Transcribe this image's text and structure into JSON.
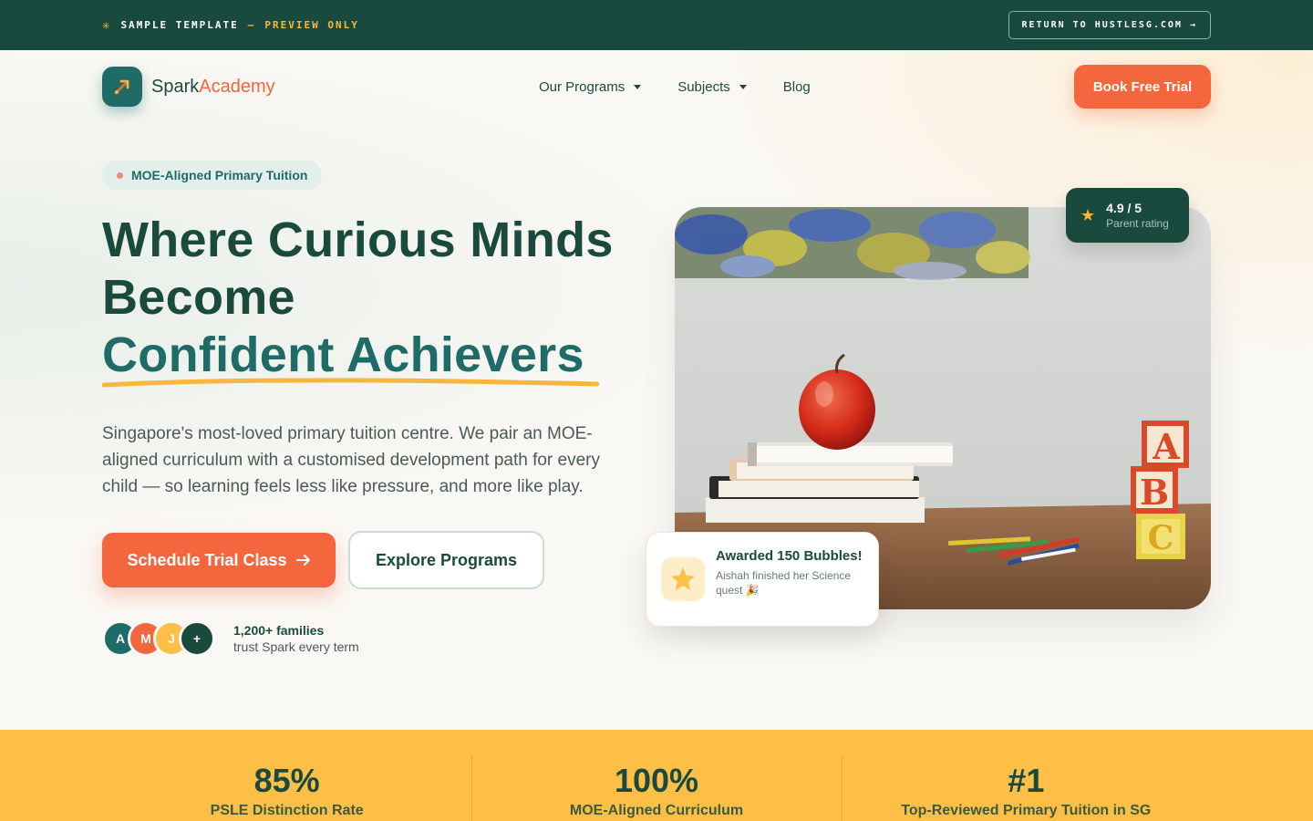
{
  "banner": {
    "template_label": "SAMPLE TEMPLATE",
    "dash": "—",
    "preview_label": "PREVIEW ONLY",
    "return_link": "RETURN TO HUSTLESG.COM →"
  },
  "brand": {
    "name_part1": "Spark",
    "name_part2": "Academy",
    "primary_color": "#1f6b68",
    "accent_color": "#f4663d",
    "dark_color": "#1a4a3e",
    "highlight_color": "#fdbf45"
  },
  "nav": {
    "items": [
      {
        "label": "Our Programs",
        "has_dropdown": true
      },
      {
        "label": "Subjects",
        "has_dropdown": true
      },
      {
        "label": "Blog",
        "has_dropdown": false
      }
    ],
    "cta_label": "Book Free Trial"
  },
  "hero": {
    "badge": "MOE-Aligned Primary Tuition",
    "headline_line1": "Where Curious Minds",
    "headline_line2": "Become",
    "headline_accent": "Confident Achievers",
    "lede": "Singapore's most-loved primary tuition centre. We pair an MOE-aligned curriculum with a customised development path for every child — so learning feels less like pressure, and more like play.",
    "primary_cta": "Schedule Trial Class",
    "secondary_cta": "Explore Programs",
    "avatars": [
      {
        "initial": "A",
        "color": "#1f6b68"
      },
      {
        "initial": "M",
        "color": "#f4663d"
      },
      {
        "initial": "J",
        "color": "#fdbf45"
      },
      {
        "initial": "+",
        "color": "#1a4a3e"
      }
    ],
    "trust_count": "1,200+ families",
    "trust_text": "trust Spark every term"
  },
  "rating_card": {
    "value": "4.9 / 5",
    "label": "Parent rating",
    "icon": "star-icon"
  },
  "award_card": {
    "title": "Awarded 150 Bubbles!",
    "subtitle": "Aishah finished her Science quest 🎉",
    "icon": "star-icon"
  },
  "stats": [
    {
      "value": "85%",
      "label": "PSLE Distinction Rate"
    },
    {
      "value": "100%",
      "label": "MOE-Aligned Curriculum"
    },
    {
      "value": "#1",
      "label": "Top-Reviewed Primary Tuition in SG"
    }
  ]
}
